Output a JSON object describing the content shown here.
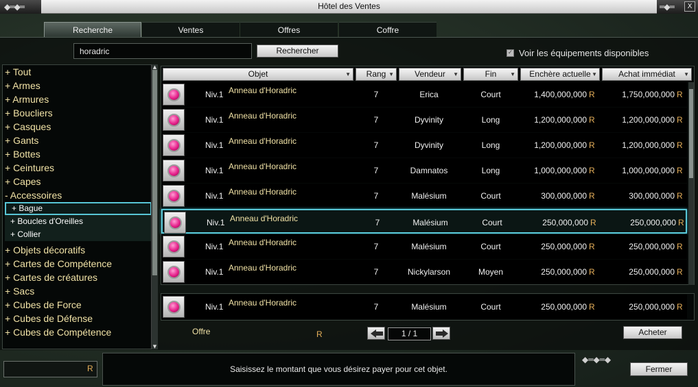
{
  "window": {
    "title": "Hôtel des Ventes",
    "close_glyph": "X"
  },
  "tabs": [
    {
      "label": "Recherche",
      "active": true
    },
    {
      "label": "Ventes",
      "active": false
    },
    {
      "label": "Offres",
      "active": false
    },
    {
      "label": "Coffre",
      "active": false
    }
  ],
  "search": {
    "value": "horadric",
    "button_label": "Rechercher",
    "show_available_label": "Voir les équipements disponibles",
    "show_available_checked": true
  },
  "categories": [
    {
      "label": "+ Tout"
    },
    {
      "label": "+ Armes"
    },
    {
      "label": "+ Armures"
    },
    {
      "label": "+ Boucliers"
    },
    {
      "label": "+ Casques"
    },
    {
      "label": "+ Gants"
    },
    {
      "label": "+ Bottes"
    },
    {
      "label": "+ Ceintures"
    },
    {
      "label": "+ Capes"
    },
    {
      "label": "- Accessoires"
    },
    {
      "label": "+ Bague",
      "sub": true,
      "selected": true
    },
    {
      "label": "+ Boucles d'Oreilles",
      "sub": true
    },
    {
      "label": "+ Collier",
      "sub": true
    },
    {
      "label": "+ Objets décoratifs"
    },
    {
      "label": "+ Cartes de Compétence"
    },
    {
      "label": "+ Cartes de créatures"
    },
    {
      "label": "+ Sacs"
    },
    {
      "label": "+ Cubes de Force"
    },
    {
      "label": "+ Cubes de Défense"
    },
    {
      "label": "+ Cubes de Compétence"
    }
  ],
  "columns": {
    "item": "Objet",
    "rank": "Rang",
    "seller": "Vendeur",
    "end": "Fin",
    "bid": "Enchère actuelle",
    "buyout": "Achat immédiat"
  },
  "currency_symbol": "R",
  "listings": [
    {
      "level": "Niv.1",
      "name": "Anneau d'Horadric",
      "rank": "7",
      "seller": "Erica",
      "end": "Court",
      "bid": "1,400,000,000",
      "buyout": "1,750,000,000"
    },
    {
      "level": "Niv.1",
      "name": "Anneau d'Horadric",
      "rank": "7",
      "seller": "Dyvinity",
      "end": "Long",
      "bid": "1,200,000,000",
      "buyout": "1,200,000,000"
    },
    {
      "level": "Niv.1",
      "name": "Anneau d'Horadric",
      "rank": "7",
      "seller": "Dyvinity",
      "end": "Long",
      "bid": "1,200,000,000",
      "buyout": "1,200,000,000"
    },
    {
      "level": "Niv.1",
      "name": "Anneau d'Horadric",
      "rank": "7",
      "seller": "Damnatos",
      "end": "Long",
      "bid": "1,000,000,000",
      "buyout": "1,000,000,000"
    },
    {
      "level": "Niv.1",
      "name": "Anneau d'Horadric",
      "rank": "7",
      "seller": "Malésium",
      "end": "Court",
      "bid": "300,000,000",
      "buyout": "300,000,000"
    },
    {
      "level": "Niv.1",
      "name": "Anneau d'Horadric",
      "rank": "7",
      "seller": "Malésium",
      "end": "Court",
      "bid": "250,000,000",
      "buyout": "250,000,000",
      "selected": true
    },
    {
      "level": "Niv.1",
      "name": "Anneau d'Horadric",
      "rank": "7",
      "seller": "Malésium",
      "end": "Court",
      "bid": "250,000,000",
      "buyout": "250,000,000"
    },
    {
      "level": "Niv.1",
      "name": "Anneau d'Horadric",
      "rank": "7",
      "seller": "Nickylarson",
      "end": "Moyen",
      "bid": "250,000,000",
      "buyout": "250,000,000"
    }
  ],
  "selected_item": {
    "level": "Niv.1",
    "name": "Anneau d'Horadric",
    "rank": "7",
    "seller": "Malésium",
    "end": "Court",
    "bid": "250,000,000",
    "buyout": "250,000,000"
  },
  "offer": {
    "label": "Offre",
    "currency_symbol": "R"
  },
  "pagination": {
    "text": "1 / 1"
  },
  "buy_button_label": "Acheter",
  "bottom": {
    "amount_currency": "R",
    "message": "Saisissez le montant que vous désirez payer pour cet objet.",
    "close_label": "Fermer"
  },
  "colors": {
    "accent_selection": "#58c6d6",
    "item_name": "#f1e2a6",
    "currency": "#e7b05a"
  }
}
